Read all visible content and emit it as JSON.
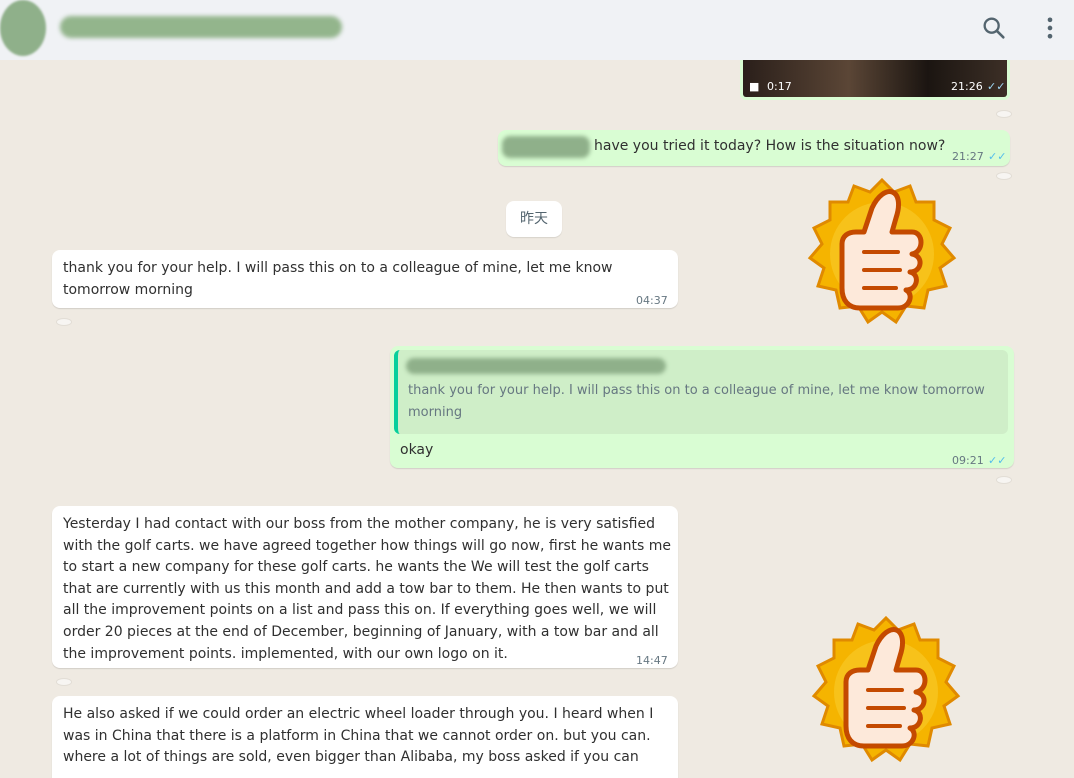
{
  "header": {
    "search_icon": "search-icon",
    "menu_icon": "more-vertical-icon"
  },
  "video": {
    "duration": "0:17",
    "time": "21:26",
    "ticks": "✓✓"
  },
  "messages": {
    "m1": {
      "text": "have you tried it today? How is the situation now?",
      "time": "21:27",
      "ticks": "✓✓"
    },
    "date_divider": "昨天",
    "m2": {
      "text": "thank you for your help. I will pass this on to a colleague of mine, let me know\ntomorrow morning",
      "time": "04:37"
    },
    "m3": {
      "quoted": "thank you for your help. I will pass this on to a colleague of mine, let me know tomorrow\nmorning",
      "text": "okay",
      "time": "09:21",
      "ticks": "✓✓"
    },
    "m4": {
      "text": "Yesterday I had contact with our boss from the mother company, he is very satisfied\nwith the golf carts. we have agreed together how things will go now, first he wants me\nto start a new company for these golf carts. he wants the We will test the golf carts\nthat are currently with us this month and add a tow bar to them. He then wants to put\nall the improvement points on a list and pass this on. If everything goes well, we will\norder 20 pieces at the end of December, beginning of January, with a tow bar and all\nthe improvement points. implemented, with our own logo on it.",
      "time": "14:47"
    },
    "m5": {
      "text": "He also asked if we could order an electric wheel loader through you. I heard when I\nwas in China that there is a platform in China that we cannot order on. but you can.\nwhere a lot of things are sold, even bigger than Alibaba, my boss asked if you can"
    }
  },
  "stickers": [
    "thumbs-up-sticker",
    "thumbs-up-sticker"
  ],
  "colors": {
    "chat_bg": "#efeae2",
    "outgoing": "#d9fdd3",
    "incoming": "#ffffff",
    "ticks": "#53bdeb",
    "quote_bar": "#06cf9c"
  }
}
